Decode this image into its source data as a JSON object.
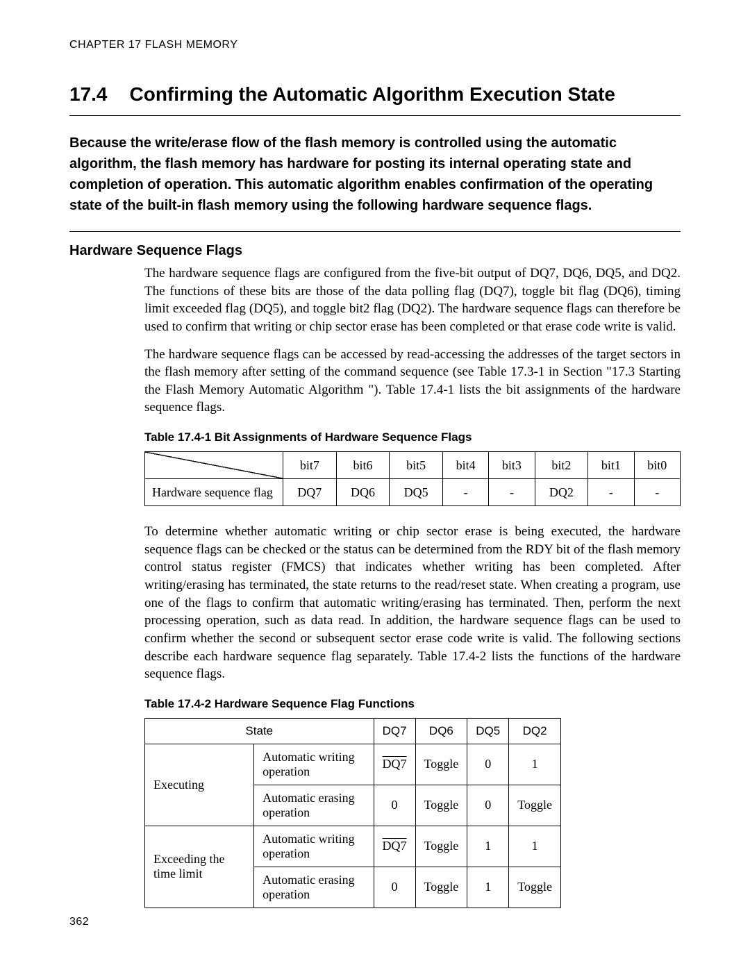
{
  "running_head": "CHAPTER 17  FLASH MEMORY",
  "section_number": "17.4",
  "section_title": "Confirming the Automatic Algorithm Execution State",
  "intro": "Because the write/erase flow of the flash memory is controlled using the automatic algorithm, the flash memory has hardware for posting its internal operating state and completion of operation. This automatic algorithm enables confirmation of the operating state of the built-in flash memory using the following hardware sequence flags.",
  "subhead": "Hardware Sequence Flags",
  "para1": "The hardware sequence flags are configured from the five-bit output of DQ7, DQ6, DQ5, and DQ2. The functions of these bits are those of the data polling flag (DQ7), toggle bit flag (DQ6), timing limit exceeded flag (DQ5), and toggle bit2 flag (DQ2). The hardware sequence flags can therefore be used to confirm that writing or chip sector erase has been completed or that erase code write is valid.",
  "para2": "The hardware sequence flags can be accessed by read-accessing the addresses of the target sectors in the flash memory after setting of the command sequence (see Table 17.3-1 in Section \"17.3  Starting the Flash Memory Automatic Algorithm \"). Table 17.4-1 lists the bit assignments of the hardware sequence flags.",
  "table1": {
    "caption": "Table 17.4-1  Bit Assignments of Hardware Sequence Flags",
    "headers": [
      "",
      "bit7",
      "bit6",
      "bit5",
      "bit4",
      "bit3",
      "bit2",
      "bit1",
      "bit0"
    ],
    "row_label": "Hardware sequence flag",
    "row": [
      "DQ7",
      "DQ6",
      "DQ5",
      "-",
      "-",
      "DQ2",
      "-",
      "-"
    ]
  },
  "para3": "To determine whether automatic writing or chip sector erase is being executed, the hardware sequence flags can be checked or the status can be determined from the RDY bit of the flash memory control status register (FMCS) that indicates whether writing has been completed. After writing/erasing has terminated, the state returns to the read/reset state. When creating a program, use one of the flags to confirm that automatic writing/erasing has terminated. Then, perform the next processing operation, such as data read. In addition, the hardware sequence flags can be used to confirm whether the second or subsequent sector erase code write is valid. The following sections describe each hardware sequence flag separately. Table 17.4-2 lists the functions of the hardware sequence flags.",
  "table2": {
    "caption": "Table 17.4-2  Hardware Sequence Flag Functions",
    "head_state": "State",
    "head_cols": [
      "DQ7",
      "DQ6",
      "DQ5",
      "DQ2"
    ],
    "groups": [
      {
        "label": "Executing",
        "rows": [
          {
            "op": "Automatic writing operation",
            "cells": [
              "DQ7_BAR",
              "Toggle",
              "0",
              "1"
            ]
          },
          {
            "op": "Automatic erasing operation",
            "cells": [
              "0",
              "Toggle",
              "0",
              "Toggle"
            ]
          }
        ]
      },
      {
        "label": "Exceeding the time limit",
        "rows": [
          {
            "op": "Automatic writing operation",
            "cells": [
              "DQ7_BAR",
              "Toggle",
              "1",
              "1"
            ]
          },
          {
            "op": "Automatic erasing operation",
            "cells": [
              "0",
              "Toggle",
              "1",
              "Toggle"
            ]
          }
        ]
      }
    ]
  },
  "page_number": "362"
}
